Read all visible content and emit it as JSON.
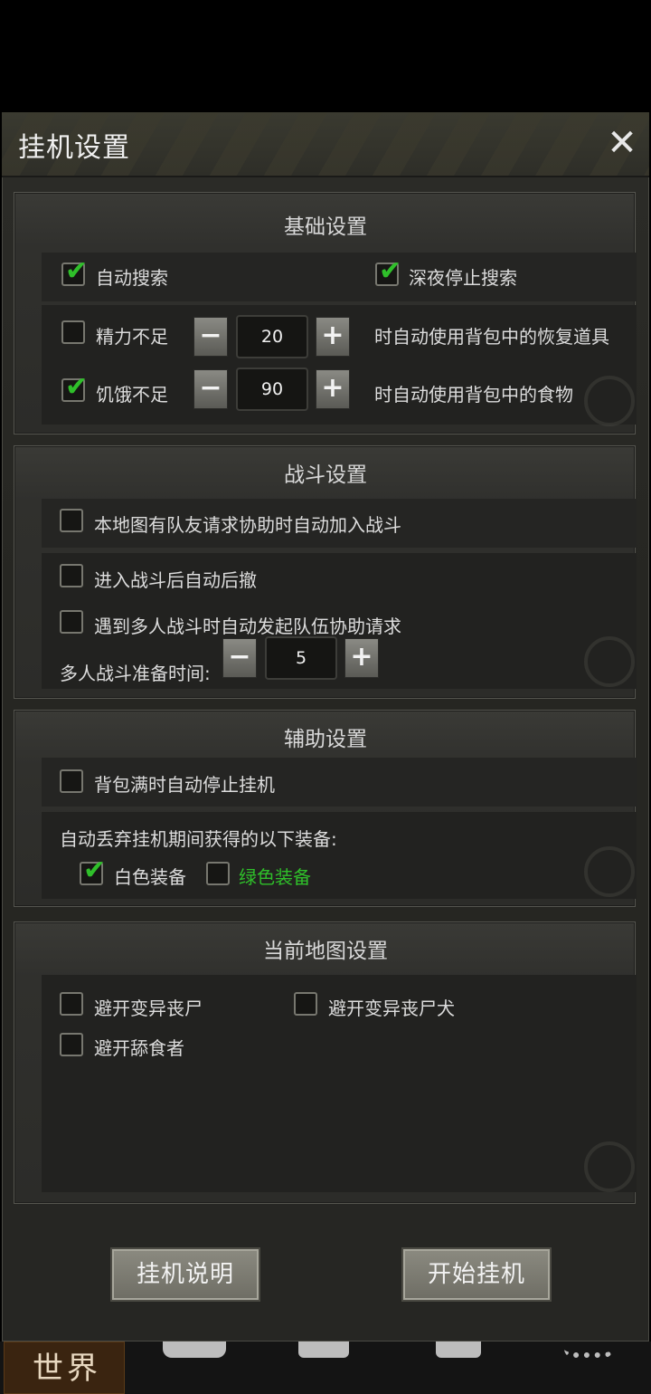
{
  "dialog": {
    "title": "挂机设置",
    "close_icon": "close-icon"
  },
  "basic": {
    "title": "基础设置",
    "auto_search": {
      "label": "自动搜索",
      "checked": true
    },
    "night_stop": {
      "label": "深夜停止搜索",
      "checked": true
    },
    "energy": {
      "label": "精力不足",
      "checked": false,
      "value": "20",
      "suffix": "时自动使用背包中的恢复道具"
    },
    "hunger": {
      "label": "饥饿不足",
      "checked": true,
      "value": "90",
      "suffix": "时自动使用背包中的食物"
    }
  },
  "battle": {
    "title": "战斗设置",
    "auto_join": {
      "label": "本地图有队友请求协助时自动加入战斗",
      "checked": false
    },
    "auto_retreat": {
      "label": "进入战斗后自动后撤",
      "checked": false
    },
    "auto_request": {
      "label": "遇到多人战斗时自动发起队伍协助请求",
      "checked": false
    },
    "prep_time": {
      "label": "多人战斗准备时间:",
      "value": "5"
    }
  },
  "assist": {
    "title": "辅助设置",
    "bag_full": {
      "label": "背包满时自动停止挂机",
      "checked": false
    },
    "discard_label": "自动丢弃挂机期间获得的以下装备:",
    "white": {
      "label": "白色装备",
      "checked": true
    },
    "green": {
      "label": "绿色装备",
      "checked": false,
      "color": "#2fbf2a"
    }
  },
  "map": {
    "title": "当前地图设置",
    "avoid_mutant_zombie": {
      "label": "避开变异丧尸",
      "checked": false
    },
    "avoid_mutant_dog": {
      "label": "避开变异丧尸犬",
      "checked": false
    },
    "avoid_licker": {
      "label": "避开舔食者",
      "checked": false
    }
  },
  "footer": {
    "help_label": "挂机说明",
    "start_label": "开始挂机"
  },
  "bottom_nav": {
    "world_label": "世界"
  },
  "colors": {
    "check_green": "#2fbf2a",
    "panel_bg": "#2c2c29"
  }
}
